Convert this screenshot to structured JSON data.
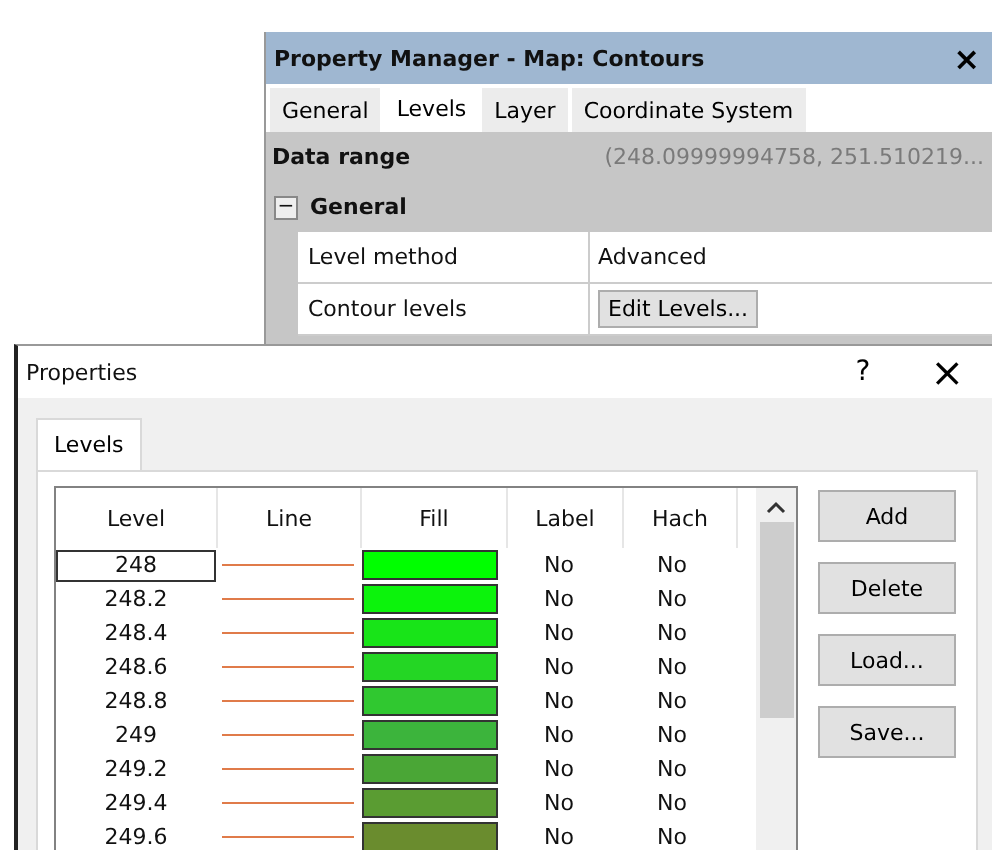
{
  "property_manager": {
    "title": "Property Manager - Map: Contours",
    "close": "×",
    "tabs": [
      {
        "label": "General",
        "selected": false
      },
      {
        "label": "Levels",
        "selected": true
      },
      {
        "label": "Layer",
        "selected": false
      },
      {
        "label": "Coordinate System",
        "selected": false
      }
    ],
    "rows": [
      {
        "kind": "header",
        "label": "Data range",
        "value": "(248.09999994758, 251.510219..."
      },
      {
        "kind": "group",
        "toggle": "−",
        "label": "General"
      },
      {
        "kind": "text",
        "label": "Level method",
        "value": "Advanced"
      },
      {
        "kind": "button",
        "label": "Contour levels",
        "value": "Edit Levels..."
      }
    ]
  },
  "dialog": {
    "title": "Properties",
    "help": "?",
    "close": "×",
    "tabs": [
      {
        "label": "Levels",
        "selected": true
      }
    ],
    "table": {
      "columns": [
        "Level",
        "Line",
        "Fill",
        "Label",
        "Hach"
      ],
      "rows": [
        {
          "level": "248",
          "color": "#00ff00",
          "label": "No",
          "hach": "No",
          "selected": true
        },
        {
          "level": "248.2",
          "color": "#0cf30c",
          "label": "No",
          "hach": "No",
          "selected": false
        },
        {
          "level": "248.4",
          "color": "#18e418",
          "label": "No",
          "hach": "No",
          "selected": false
        },
        {
          "level": "248.6",
          "color": "#24d624",
          "label": "No",
          "hach": "No",
          "selected": false
        },
        {
          "level": "248.8",
          "color": "#30c830",
          "label": "No",
          "hach": "No",
          "selected": false
        },
        {
          "level": "249",
          "color": "#3cb43c",
          "label": "No",
          "hach": "No",
          "selected": false
        },
        {
          "level": "249.2",
          "color": "#4aa636",
          "label": "No",
          "hach": "No",
          "selected": false
        },
        {
          "level": "249.4",
          "color": "#5a9c32",
          "label": "No",
          "hach": "No",
          "selected": false
        },
        {
          "level": "249.6",
          "color": "#6a8c2e",
          "label": "No",
          "hach": "No",
          "selected": false
        }
      ]
    },
    "buttons": [
      "Add",
      "Delete",
      "Load...",
      "Save..."
    ]
  }
}
